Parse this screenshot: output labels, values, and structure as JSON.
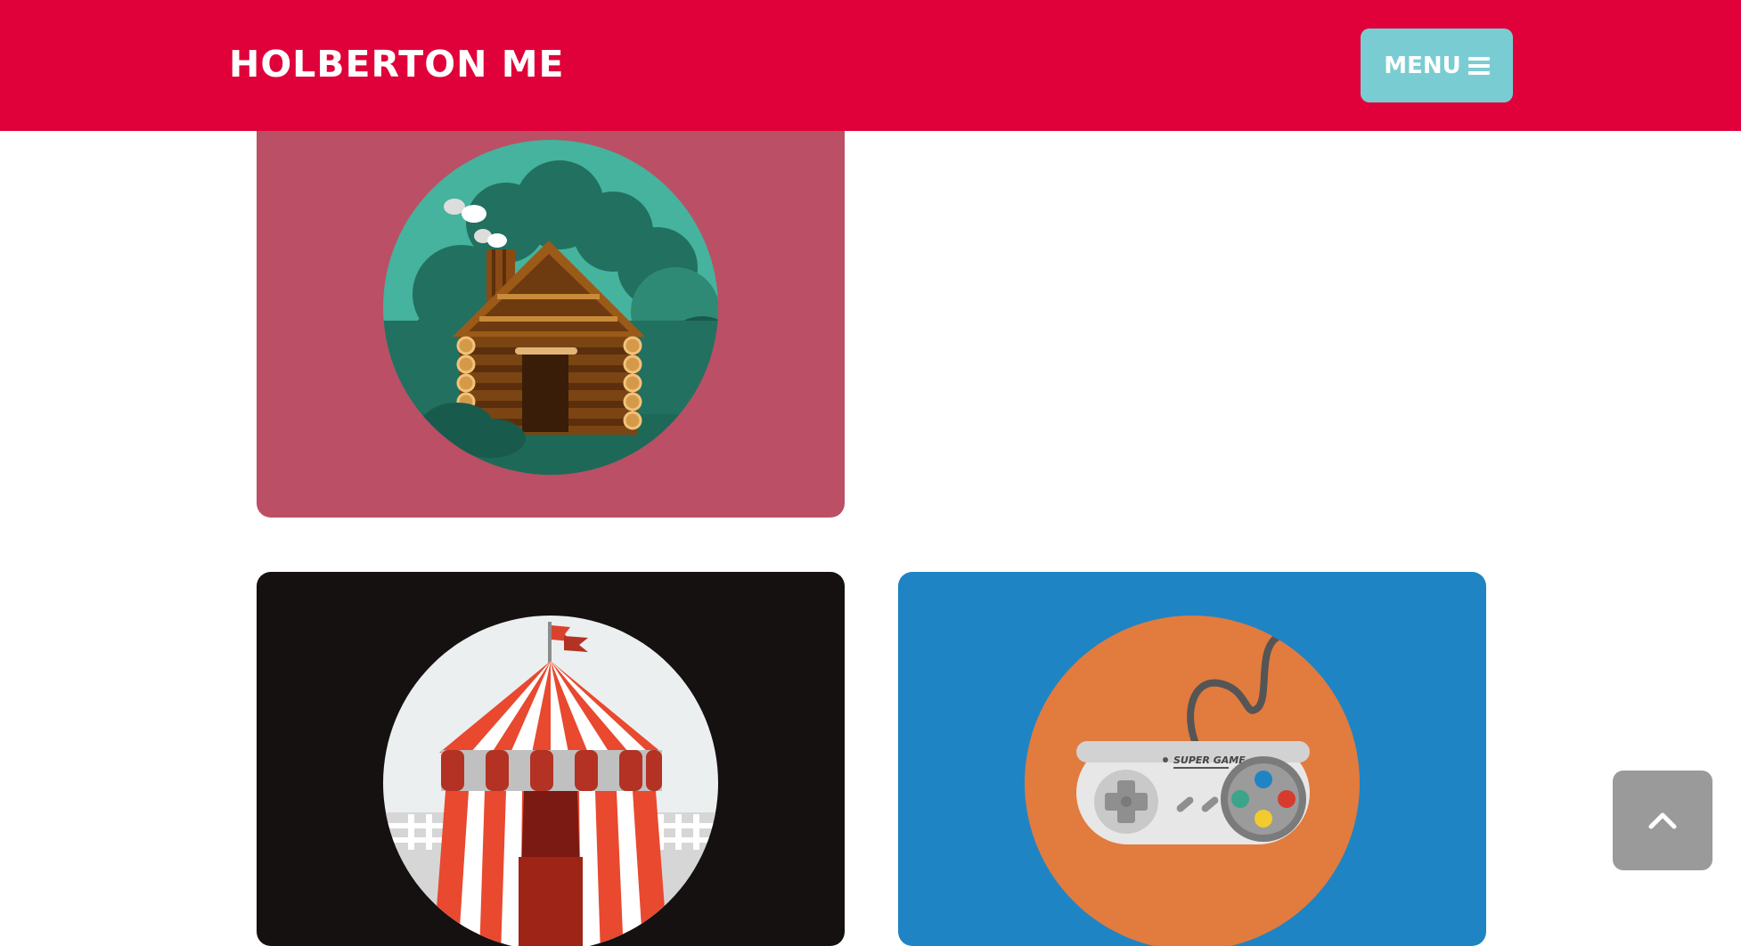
{
  "header": {
    "brand": "HOLBERTON ME",
    "menu_label": "MENU",
    "menu_icon": "hamburger-icon",
    "background": "#e0003a",
    "menu_background": "#79cdd2"
  },
  "portfolio": {
    "items": [
      {
        "name": "cabin",
        "illustration": "log-cabin-icon",
        "background": "#bb4f65",
        "circle": "#45b39d"
      },
      {
        "name": "circus",
        "illustration": "circus-tent-icon",
        "background": "#141110",
        "circle": "#eceff0"
      },
      {
        "name": "game",
        "illustration": "game-controller-icon",
        "background": "#1f84c4",
        "circle": "#e27b3e",
        "controller_label": "SUPER GAME"
      }
    ]
  },
  "scroll_top": {
    "icon": "chevron-up-icon",
    "background": "#9a9a9a"
  }
}
